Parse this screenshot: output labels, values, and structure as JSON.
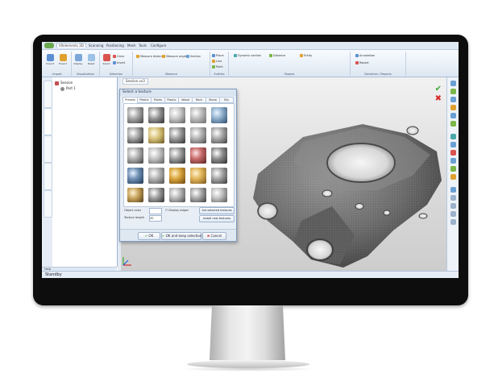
{
  "titlebar": {
    "app_tab": "VXelements 3D",
    "menu_tabs": [
      "Scanning",
      "Positioning",
      "Mesh",
      "Tools",
      "Configure"
    ]
  },
  "ribbon": {
    "groups": [
      {
        "name": "Import",
        "buttons": [
          "Import",
          "Export"
        ]
      },
      {
        "name": "Visualization",
        "buttons": [
          "Display",
          "Reset"
        ]
      },
      {
        "name": "Selection",
        "buttons": [
          "Select",
          "Clear",
          "Invert"
        ]
      },
      {
        "name": "Measure",
        "buttons": [
          "Measure distance",
          "Measure angle",
          "Section"
        ]
      },
      {
        "name": "Entities",
        "buttons": [
          "Plane",
          "Line",
          "Point"
        ]
      },
      {
        "name": "Shapes",
        "buttons": [
          "Dynamic section",
          "Distance",
          "Entity"
        ]
      },
      {
        "name": "Deviation / Reports",
        "buttons": [
          "Annotation",
          "Report"
        ]
      }
    ],
    "colors": {
      "ribbon_top": "#f8fbff",
      "ribbon_bottom": "#dde7f2"
    }
  },
  "tree": {
    "items": [
      {
        "label": "Session",
        "level": 0
      },
      {
        "label": "Part 1",
        "level": 1
      }
    ]
  },
  "left_tabs": [
    "Scan",
    "Session",
    "Layers",
    "Properties",
    "Surfaces"
  ],
  "help_label": "Help",
  "viewport": {
    "doc_tab": "Session.vx3",
    "accent_check": "#3aa832",
    "accent_close": "#d62b2b"
  },
  "dialog": {
    "title": "Select a texture",
    "tabs": [
      "Presets",
      "Plastic",
      "Paints",
      "Plastic",
      "Wood",
      "Rock",
      "Stone",
      "Sky"
    ],
    "object_color_label": "Object color",
    "texture_length_label": "Texture length",
    "texture_length_value": "30",
    "display_edges_label": "Display edges",
    "texture_btn": "Set selected textures",
    "install_btn": "Install new textures",
    "ok_label": "OK",
    "apply_label": "OK and keep selection",
    "cancel_label": "Cancel"
  },
  "status": {
    "text": "Standby"
  }
}
